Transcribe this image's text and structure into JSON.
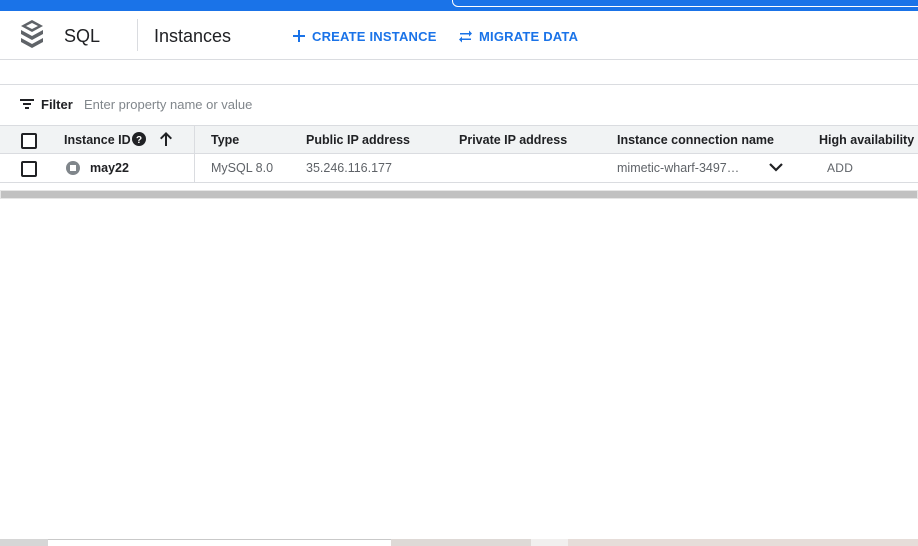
{
  "header": {
    "product_icon": "sql-stack-icon",
    "product_name": "SQL",
    "page_title": "Instances",
    "actions": [
      {
        "label": "CREATE INSTANCE",
        "icon": "plus-icon"
      },
      {
        "label": "MIGRATE DATA",
        "icon": "swap-arrows-icon"
      }
    ]
  },
  "filter": {
    "label": "Filter",
    "placeholder": "Enter property name or value",
    "icon": "filter-lines-icon"
  },
  "table": {
    "columns": [
      "Instance ID",
      "Type",
      "Public IP address",
      "Private IP address",
      "Instance connection name",
      "High availability"
    ],
    "rows": [
      {
        "instance_id": "may22",
        "status_icon": "stopped-status-icon",
        "type": "MySQL 8.0",
        "public_ip": "35.246.116.177",
        "private_ip": "",
        "connection_name": "mimetic-wharf-3497…",
        "high_availability_action": "ADD"
      }
    ]
  },
  "colors": {
    "accent": "#1a73e8",
    "header_row_bg": "#f1f3f4",
    "text_primary": "#202124",
    "text_secondary": "#5f6368"
  }
}
